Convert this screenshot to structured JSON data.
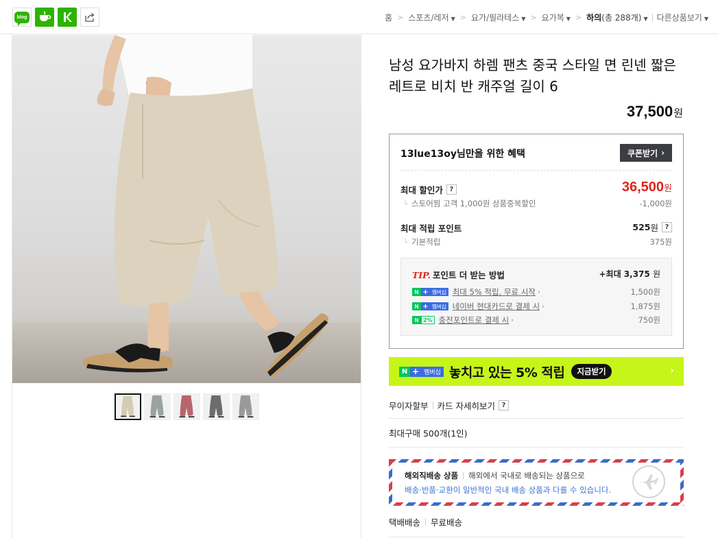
{
  "share": {
    "blog_label": "blog",
    "icons": [
      "blog-icon",
      "cafe-icon",
      "kakaostory-icon",
      "share-icon"
    ]
  },
  "breadcrumb": {
    "items": [
      "홈",
      "스포츠/레저",
      "요가/필라테스",
      "요가복"
    ],
    "current": "하의",
    "current_count": "(총 288개)",
    "other": "다른상품보기"
  },
  "product": {
    "title": "남성 요가바지 하렘 팬츠 중국 스타일 면 린넨 짧은 레트로 비치 반 캐주얼 길이 6",
    "price": "37,500",
    "won": "원",
    "thumbnail_colors": [
      "#d6cbb4",
      "#9aa3a2",
      "#b8656c",
      "#6c6c6a",
      "#9a9a98"
    ]
  },
  "benefit": {
    "heading": "13lue13oy님만을 위한 혜택",
    "coupon_button": "쿠폰받기",
    "max_discount_label": "최대 할인가",
    "max_discount_value": "36,500",
    "store_discount_label": "스토어찜 고객 1,000원 상품중복할인",
    "store_discount_value": "-1,000원",
    "max_point_label": "최대 적립 포인트",
    "max_point_value": "525",
    "basic_point_label": "기본적립",
    "basic_point_value": "375원",
    "help": "?",
    "tip": {
      "tip_word": "TIP.",
      "title": "포인트 더 받는 방법",
      "max_prefix": "+최대",
      "max_value": "3,375",
      "rows": [
        {
          "badge": "멤버십",
          "link": "최대 5% 적립, 무료 시작",
          "value": "1,500원"
        },
        {
          "badge": "멤버십",
          "link": "네이버 현대카드로 결제 시",
          "value": "1,875원"
        },
        {
          "badge": "2%",
          "link": "충전포인트로 결제 시",
          "value": "750원"
        }
      ]
    }
  },
  "promo": {
    "n_badge": "N",
    "plus_badge": "+",
    "member_badge": "멤버십",
    "text": "놓치고 있는 5% 적립",
    "button": "지금받기",
    "arrow": "›"
  },
  "payment": {
    "installment": "무이자할부",
    "card_detail": "카드 자세히보기",
    "help": "?"
  },
  "limit": {
    "text": "최대구매 500개(1인)"
  },
  "overseas": {
    "title": "해외직배송 상품",
    "desc": "해외에서 국내로 배송되는 상품으로",
    "line2": "배송·반품·교환이 일반적인 국내 배송 상품과 다를 수 있습니다."
  },
  "shipping": {
    "method": "택배배송",
    "fee": "무료배송"
  },
  "colors": {
    "brand_green": "#03c75a",
    "promo_lime": "#c6f519",
    "price_red": "#e0241b"
  }
}
